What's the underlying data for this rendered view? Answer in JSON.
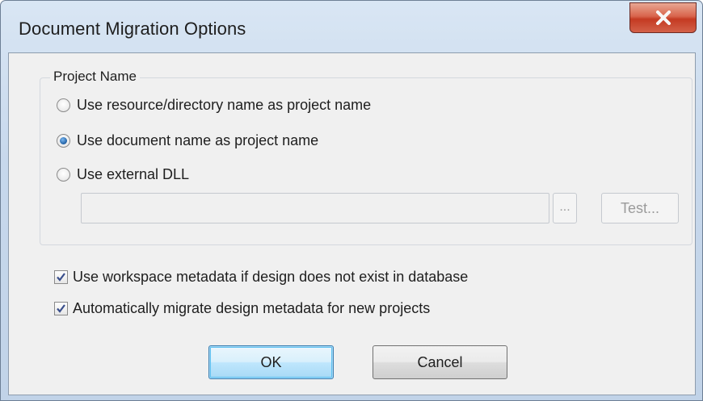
{
  "window": {
    "title": "Document Migration Options",
    "close_icon": "close-icon"
  },
  "project_name_group": {
    "legend": "Project Name",
    "options": [
      {
        "label": "Use resource/directory name as project name",
        "checked": false
      },
      {
        "label": "Use document name as project name",
        "checked": true
      },
      {
        "label": "Use external DLL",
        "checked": false
      }
    ],
    "dll_path_value": "",
    "browse_label": "...",
    "test_label": "Test..."
  },
  "checkboxes": [
    {
      "label": "Use workspace metadata if design does not exist in database",
      "checked": true
    },
    {
      "label": "Automatically migrate design metadata for new projects",
      "checked": true
    }
  ],
  "buttons": {
    "ok_label": "OK",
    "cancel_label": "Cancel"
  },
  "colors": {
    "close_button": "#c43a22",
    "radio_selected": "#1f5fa3",
    "check_mark": "#3a4f8c"
  }
}
